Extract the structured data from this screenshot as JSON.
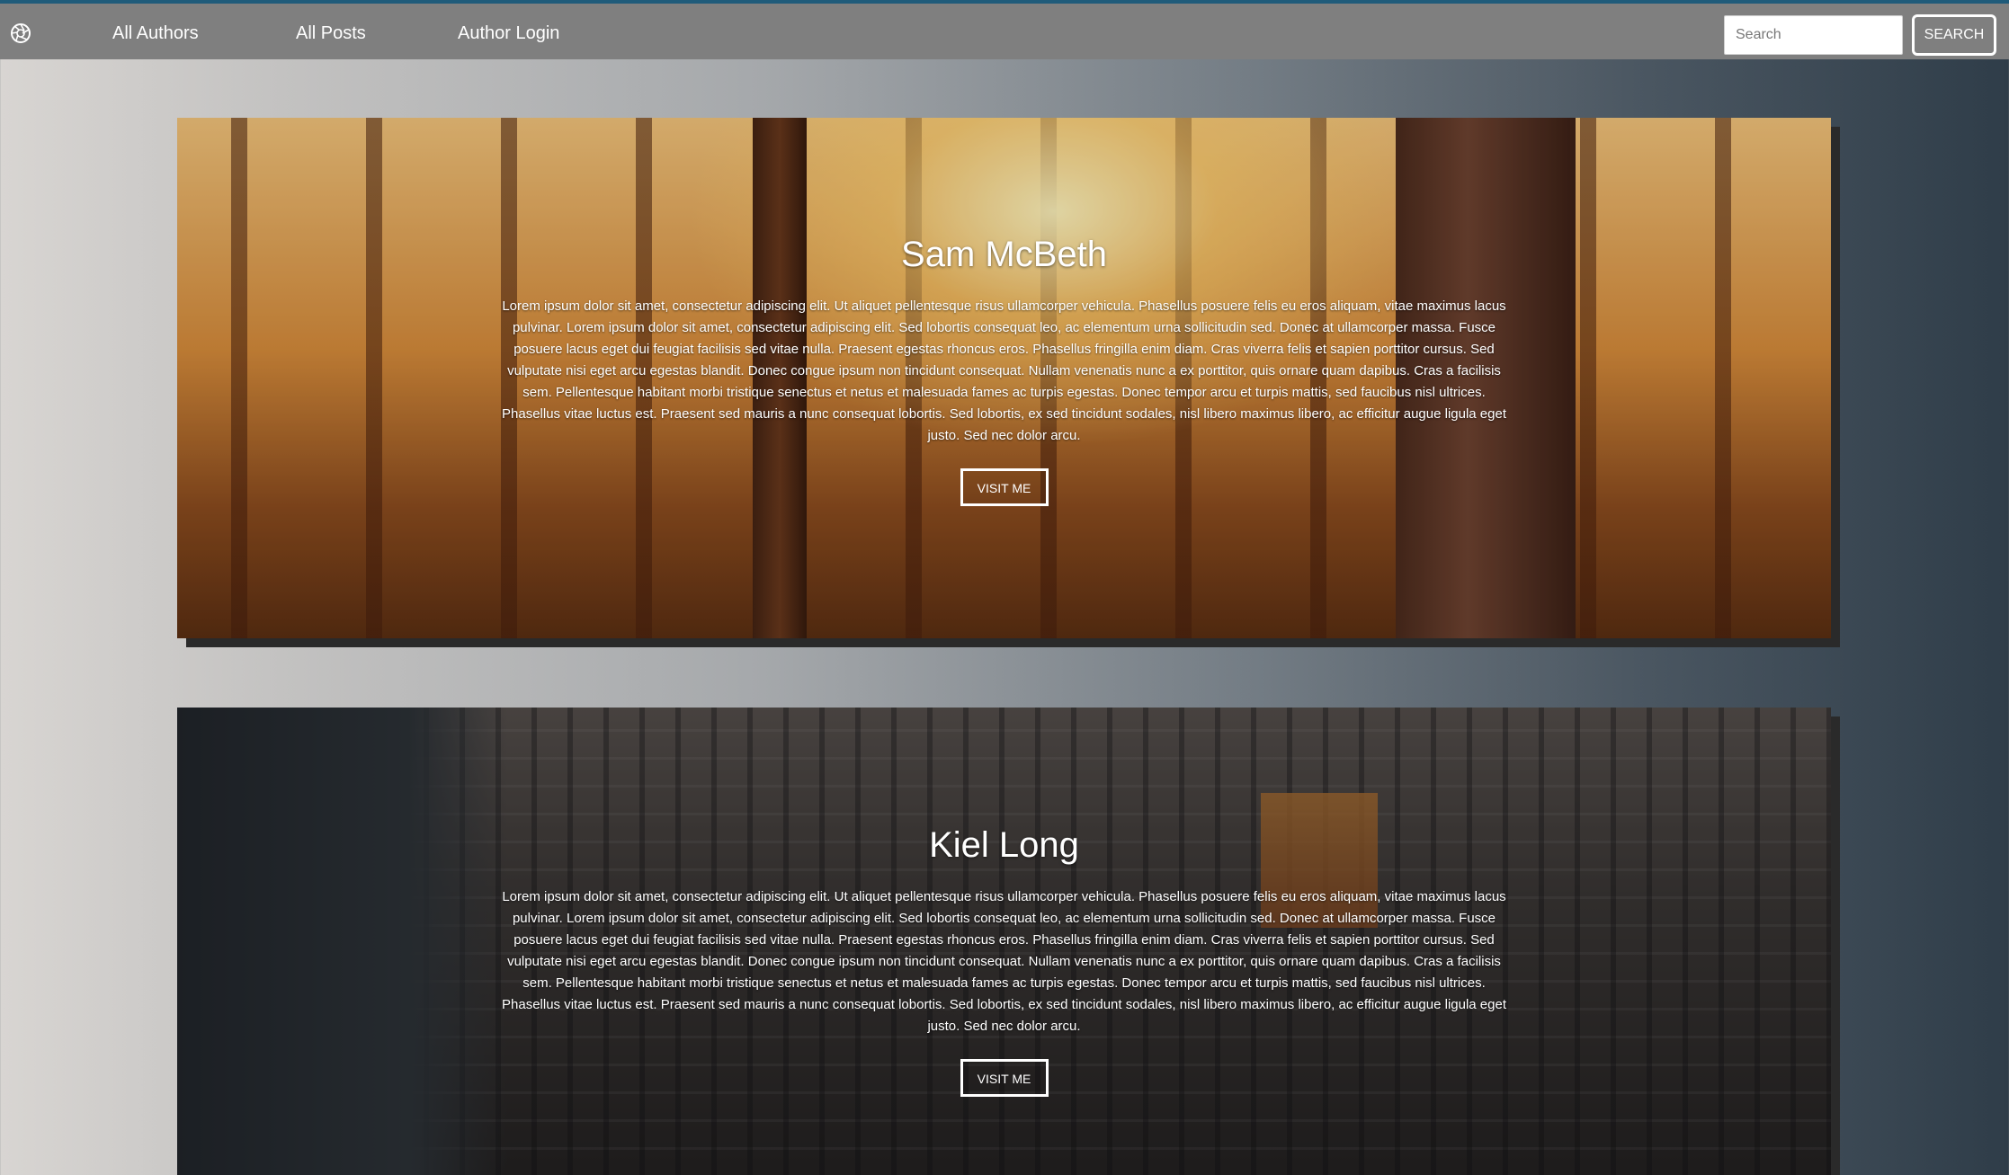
{
  "nav": {
    "logo_icon": "aperture-icon",
    "links": [
      "All Authors",
      "All Posts",
      "Author Login"
    ],
    "search_placeholder": "Search",
    "search_button": "SEARCH"
  },
  "authors": [
    {
      "name": "Sam McBeth",
      "bio": "Lorem ipsum dolor sit amet, consectetur adipiscing elit. Ut aliquet pellentesque risus ullamcorper vehicula. Phasellus posuere felis eu eros aliquam, vitae maximus lacus pulvinar. Lorem ipsum dolor sit amet, consectetur adipiscing elit. Sed lobortis consequat leo, ac elementum urna sollicitudin sed. Donec at ullamcorper massa. Fusce posuere lacus eget dui feugiat facilisis sed vitae nulla. Praesent egestas rhoncus eros. Phasellus fringilla enim diam. Cras viverra felis et sapien porttitor cursus. Sed vulputate nisi eget arcu egestas blandit. Donec congue ipsum non tincidunt consequat. Nullam venenatis nunc a ex porttitor, quis ornare quam dapibus. Cras a facilisis sem. Pellentesque habitant morbi tristique senectus et netus et malesuada fames ac turpis egestas. Donec tempor arcu et turpis mattis, sed faucibus nisl ultrices. Phasellus vitae luctus est. Praesent sed mauris a nunc consequat lobortis. Sed lobortis, ex sed tincidunt sodales, nisl libero maximus libero, ac efficitur augue ligula eget justo. Sed nec dolor arcu.",
      "button": "VISIT ME"
    },
    {
      "name": "Kiel Long",
      "bio": "Lorem ipsum dolor sit amet, consectetur adipiscing elit. Ut aliquet pellentesque risus ullamcorper vehicula. Phasellus posuere felis eu eros aliquam, vitae maximus lacus pulvinar. Lorem ipsum dolor sit amet, consectetur adipiscing elit. Sed lobortis consequat leo, ac elementum urna sollicitudin sed. Donec at ullamcorper massa. Fusce posuere lacus eget dui feugiat facilisis sed vitae nulla. Praesent egestas rhoncus eros. Phasellus fringilla enim diam. Cras viverra felis et sapien porttitor cursus. Sed vulputate nisi eget arcu egestas blandit. Donec congue ipsum non tincidunt consequat. Nullam venenatis nunc a ex porttitor, quis ornare quam dapibus. Cras a facilisis sem. Pellentesque habitant morbi tristique senectus et netus et malesuada fames ac turpis egestas. Donec tempor arcu et turpis mattis, sed faucibus nisl ultrices. Phasellus vitae luctus est. Praesent sed mauris a nunc consequat lobortis. Sed lobortis, ex sed tincidunt sodales, nisl libero maximus libero, ac efficitur augue ligula eget justo. Sed nec dolor arcu.",
      "button": "VISIT ME"
    }
  ],
  "colors": {
    "nav_background": "#7f7f7f",
    "nav_top_border": "#1f5b7a",
    "text": "#ffffff"
  }
}
